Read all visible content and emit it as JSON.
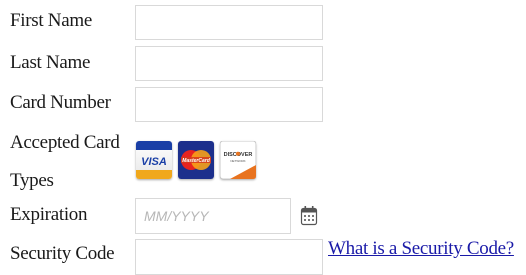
{
  "form": {
    "first_name": {
      "label": "First Name",
      "value": "",
      "placeholder": ""
    },
    "last_name": {
      "label": "Last Name",
      "value": "",
      "placeholder": ""
    },
    "card_number": {
      "label": "Card Number",
      "value": "",
      "placeholder": ""
    },
    "accepted_cards": {
      "label_line1": "Accepted Card",
      "label_line2": "Types",
      "cards": [
        {
          "name": "visa",
          "text": "VISA",
          "color": "#1a3fa6"
        },
        {
          "name": "mastercard",
          "text": "MasterCard",
          "color": "#f39c12"
        },
        {
          "name": "discover",
          "text": "DISCOVER",
          "color": "#e8731f"
        }
      ]
    },
    "expiration": {
      "label": "Expiration",
      "value": "",
      "placeholder": "MM/YYYY"
    },
    "security_code": {
      "label": "Security Code",
      "value": "",
      "placeholder": "",
      "help_link": "What is a Security Code?"
    }
  },
  "colors": {
    "link": "#1a1aa8",
    "border": "#d9d9d9",
    "placeholder": "#b7b7b7"
  }
}
